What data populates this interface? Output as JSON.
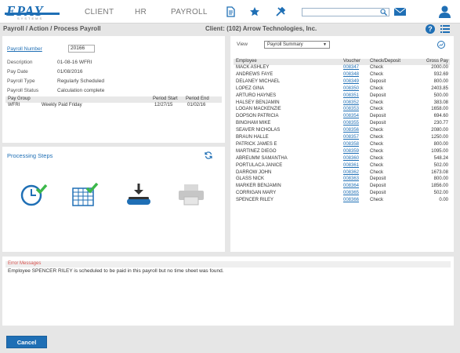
{
  "brand": {
    "logo_text": "EPAY",
    "logo_sub": "SYSTEMS"
  },
  "nav": {
    "client": "CLIENT",
    "hr": "HR",
    "payroll": "PAYROLL"
  },
  "search": {
    "value": "",
    "placeholder": ""
  },
  "breadcrumb": "Payroll / Action / Process Payroll",
  "client_title": "Client: (102) Arrow Technologies, Inc.",
  "help_label": "?",
  "payroll": {
    "number_label": "Payroll Number",
    "number_value": "20166",
    "fields": [
      {
        "label": "Description",
        "value": "01-08-16 WFRI"
      },
      {
        "label": "Pay Date",
        "value": "01/08/2016"
      },
      {
        "label": "Payroll Type",
        "value": "Regularly Scheduled"
      },
      {
        "label": "Payroll Status",
        "value": "Calculation complete"
      }
    ],
    "group_headers": {
      "pay_group": "Pay Group",
      "start": "Period Start",
      "end": "Period End"
    },
    "group_row": {
      "code": "WFRI",
      "name": "Weekly Paid Friday",
      "start": "12/27/15",
      "end": "01/02/16"
    }
  },
  "steps": {
    "title": "Processing Steps"
  },
  "summary": {
    "view_label": "View",
    "view_value": "Payroll Summary",
    "headers": {
      "employee": "Employee",
      "voucher": "Voucher",
      "check_deposit": "Check/Deposit",
      "gross_pay": "Gross Pay"
    },
    "rows": [
      {
        "employee": "MACK ASHLEY",
        "voucher": "008347",
        "type": "Check",
        "gross": "2000.00"
      },
      {
        "employee": "ANDREWS FAYE",
        "voucher": "008348",
        "type": "Check",
        "gross": "932.69"
      },
      {
        "employee": "DELANEY MICHAEL",
        "voucher": "008349",
        "type": "Deposit",
        "gross": "800.00"
      },
      {
        "employee": "LOPEZ GINA",
        "voucher": "008350",
        "type": "Check",
        "gross": "2403.85"
      },
      {
        "employee": "ARTURO HAYNES",
        "voucher": "008351",
        "type": "Deposit",
        "gross": "500.00"
      },
      {
        "employee": "HALSEY BENJAMIN",
        "voucher": "008352",
        "type": "Check",
        "gross": "383.08"
      },
      {
        "employee": "LOGAN MACKENZIE",
        "voucher": "008353",
        "type": "Check",
        "gross": "1658.00"
      },
      {
        "employee": "DOPSON PATRICIA",
        "voucher": "008354",
        "type": "Deposit",
        "gross": "694.60"
      },
      {
        "employee": "BINGHAM MIKE",
        "voucher": "008355",
        "type": "Deposit",
        "gross": "230.77"
      },
      {
        "employee": "SEAVER NICHOLAS",
        "voucher": "008356",
        "type": "Check",
        "gross": "2080.00"
      },
      {
        "employee": "BRAUN HALLE",
        "voucher": "008357",
        "type": "Check",
        "gross": "1250.00"
      },
      {
        "employee": "PATRICK JAMES E",
        "voucher": "008358",
        "type": "Check",
        "gross": "800.00"
      },
      {
        "employee": "MARTINEZ DIEGO",
        "voucher": "008359",
        "type": "Check",
        "gross": "1095.00"
      },
      {
        "employee": "ABREUMM SAMANTHA",
        "voucher": "008360",
        "type": "Check",
        "gross": "548.24"
      },
      {
        "employee": "PORTULACA JANICE",
        "voucher": "008361",
        "type": "Check",
        "gross": "502.00"
      },
      {
        "employee": "DARROW JOHN",
        "voucher": "008362",
        "type": "Check",
        "gross": "1673.08"
      },
      {
        "employee": "GLASS NICK",
        "voucher": "008363",
        "type": "Deposit",
        "gross": "800.00"
      },
      {
        "employee": "MARKER BENJAMIN",
        "voucher": "008364",
        "type": "Deposit",
        "gross": "1856.00"
      },
      {
        "employee": "CORRIGAN MARY",
        "voucher": "008365",
        "type": "Deposit",
        "gross": "502.00"
      },
      {
        "employee": "SPENCER RILEY",
        "voucher": "008366",
        "type": "Check",
        "gross": "0.00"
      }
    ]
  },
  "errors": {
    "title": "Error Messages",
    "message": "Employee SPENCER RILEY is scheduled to be paid in this payroll but no time sheet was found."
  },
  "cancel_label": "Cancel",
  "colors": {
    "accent": "#1f6fb5",
    "error": "#d9534f",
    "success": "#3cb84a"
  }
}
